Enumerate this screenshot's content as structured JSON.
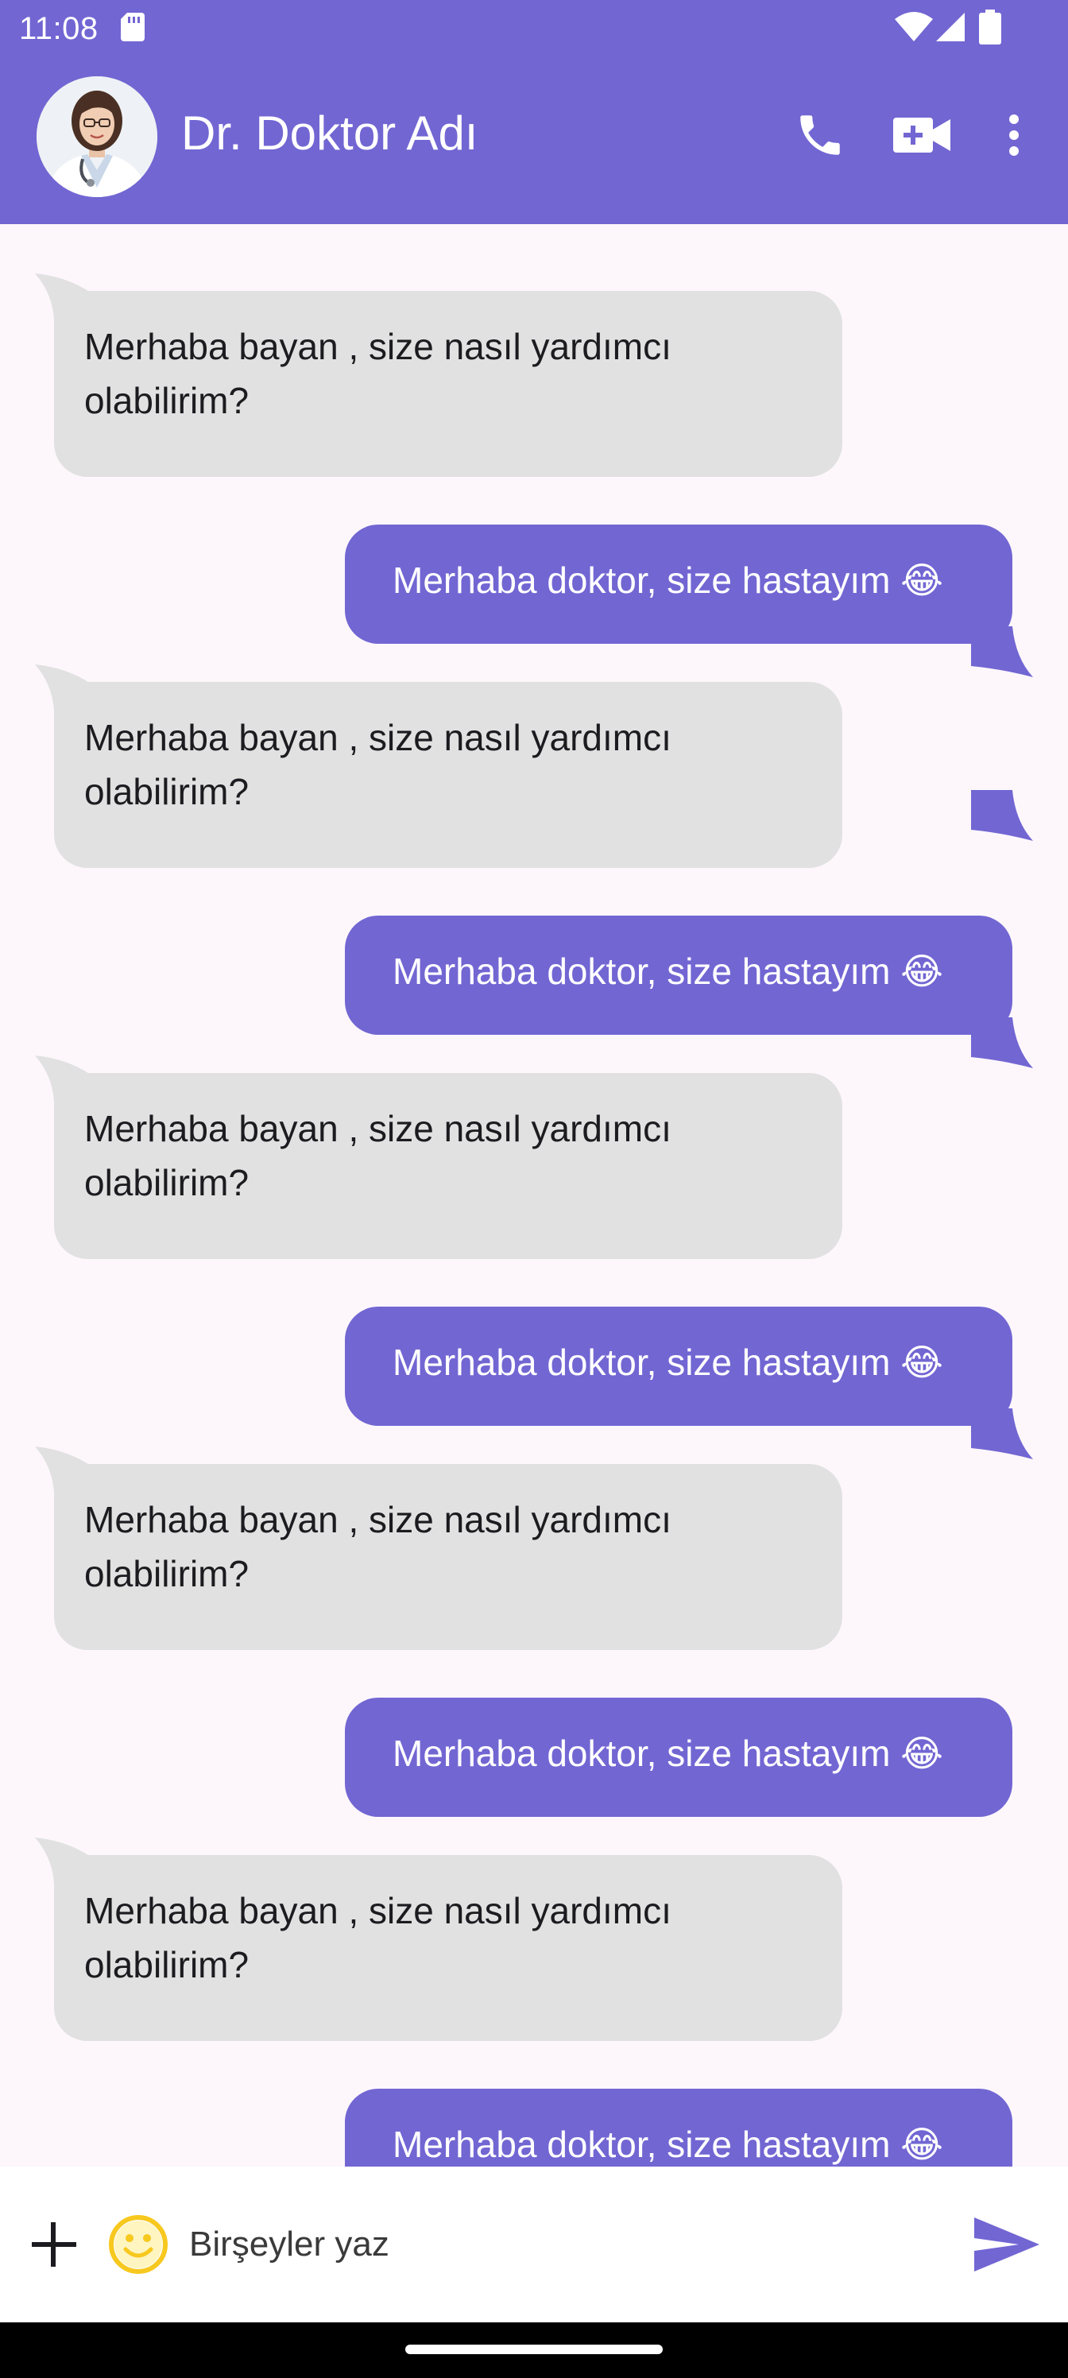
{
  "status_bar": {
    "time": "11:08",
    "icons": [
      "sd-card-icon",
      "wifi-icon",
      "signal-icon",
      "battery-icon"
    ]
  },
  "app_bar": {
    "title": "Dr. Doktor Adı",
    "avatar": "doctor-avatar",
    "actions": [
      "phone-icon",
      "video-call-icon",
      "more-vert-icon"
    ]
  },
  "colors": {
    "primary": "#7266d3",
    "incoming_bubble": "#e1e1e1",
    "chat_background": "#fdf7fb",
    "emoji_yellow": "#f7c81e"
  },
  "messages": [
    {
      "direction": "in",
      "text": "Merhaba bayan , size nasıl yardımcı olabilirim?"
    },
    {
      "direction": "out",
      "text": "Merhaba doktor, size hastayım 😂"
    },
    {
      "direction": "in",
      "text": "Merhaba bayan , size nasıl yardımcı olabilirim?"
    },
    {
      "direction": "out",
      "text": "Merhaba doktor, size hastayım 😂"
    },
    {
      "direction": "in",
      "text": "Merhaba bayan , size nasıl yardımcı olabilirim?"
    },
    {
      "direction": "out",
      "text": "Merhaba doktor, size hastayım 😂"
    },
    {
      "direction": "in",
      "text": "Merhaba bayan , size nasıl yardımcı olabilirim?"
    },
    {
      "direction": "out",
      "text": "Merhaba doktor, size hastayım 😂"
    },
    {
      "direction": "in",
      "text": "Merhaba bayan , size nasıl yardımcı olabilirim?"
    },
    {
      "direction": "out",
      "text": "Merhaba doktor, size hastayım 😂"
    }
  ],
  "input_bar": {
    "placeholder": "Birşeyler yaz",
    "value": ""
  }
}
